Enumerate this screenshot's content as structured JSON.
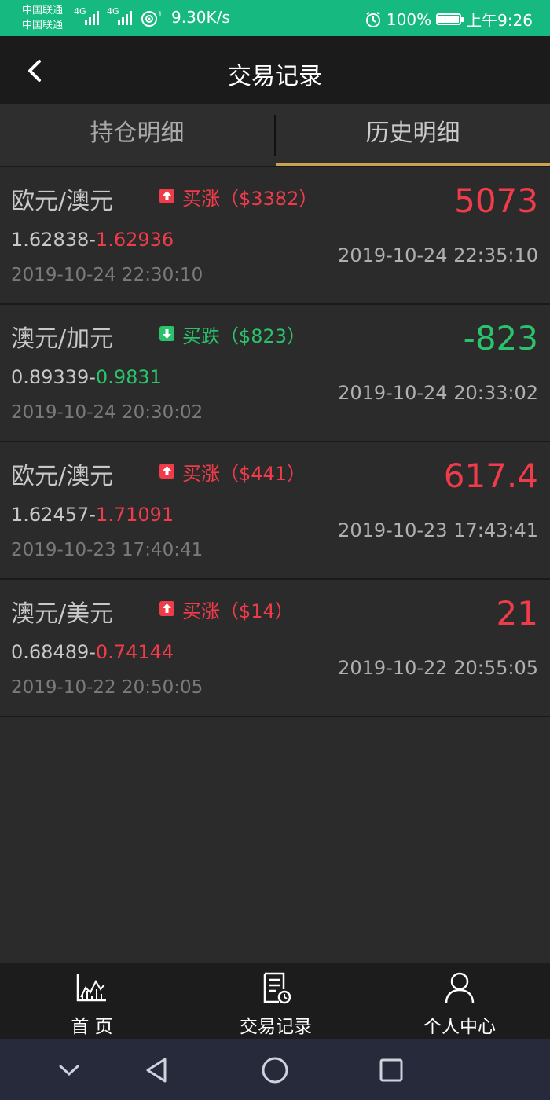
{
  "status_bar": {
    "carrier1": "中国联通",
    "carrier2": "中国联通",
    "signal1": "4G",
    "signal2": "4G",
    "speed": "9.30K/s",
    "battery": "100%",
    "time": "上午9:26"
  },
  "header": {
    "title": "交易记录",
    "back_icon": "back-arrow-icon"
  },
  "tabs": [
    {
      "label": "持仓明细",
      "active": false
    },
    {
      "label": "历史明细",
      "active": true
    }
  ],
  "records": [
    {
      "pair": "欧元/澳元",
      "direction": "up",
      "direction_label": "买涨（$3382）",
      "open_price": "1.62838",
      "close_price": "1.62936",
      "open_time": "2019-10-24 22:30:10",
      "profit": "5073",
      "close_time": "2019-10-24 22:35:10"
    },
    {
      "pair": "澳元/加元",
      "direction": "down",
      "direction_label": "买跌（$823）",
      "open_price": "0.89339",
      "close_price": "0.9831",
      "open_time": "2019-10-24 20:30:02",
      "profit": "-823",
      "close_time": "2019-10-24 20:33:02"
    },
    {
      "pair": "欧元/澳元",
      "direction": "up",
      "direction_label": "买涨（$441）",
      "open_price": "1.62457",
      "close_price": "1.71091",
      "open_time": "2019-10-23 17:40:41",
      "profit": "617.4",
      "close_time": "2019-10-23 17:43:41"
    },
    {
      "pair": "澳元/美元",
      "direction": "up",
      "direction_label": "买涨（$14）",
      "open_price": "0.68489",
      "close_price": "0.74144",
      "open_time": "2019-10-22 20:50:05",
      "profit": "21",
      "close_time": "2019-10-22 20:55:05"
    }
  ],
  "bottom_nav": [
    {
      "label": "首 页",
      "icon": "chart-icon"
    },
    {
      "label": "交易记录",
      "icon": "record-icon"
    },
    {
      "label": "个人中心",
      "icon": "user-icon"
    }
  ],
  "system_nav": [
    "collapse-icon",
    "back-triangle-icon",
    "home-circle-icon",
    "recents-square-icon"
  ],
  "colors": {
    "status_bar": "#16b980",
    "header": "#1b1b1b",
    "background": "#2b2b2b",
    "up": "#ef3b4a",
    "down": "#2ac36b",
    "tab_underline": "#c9a352"
  }
}
